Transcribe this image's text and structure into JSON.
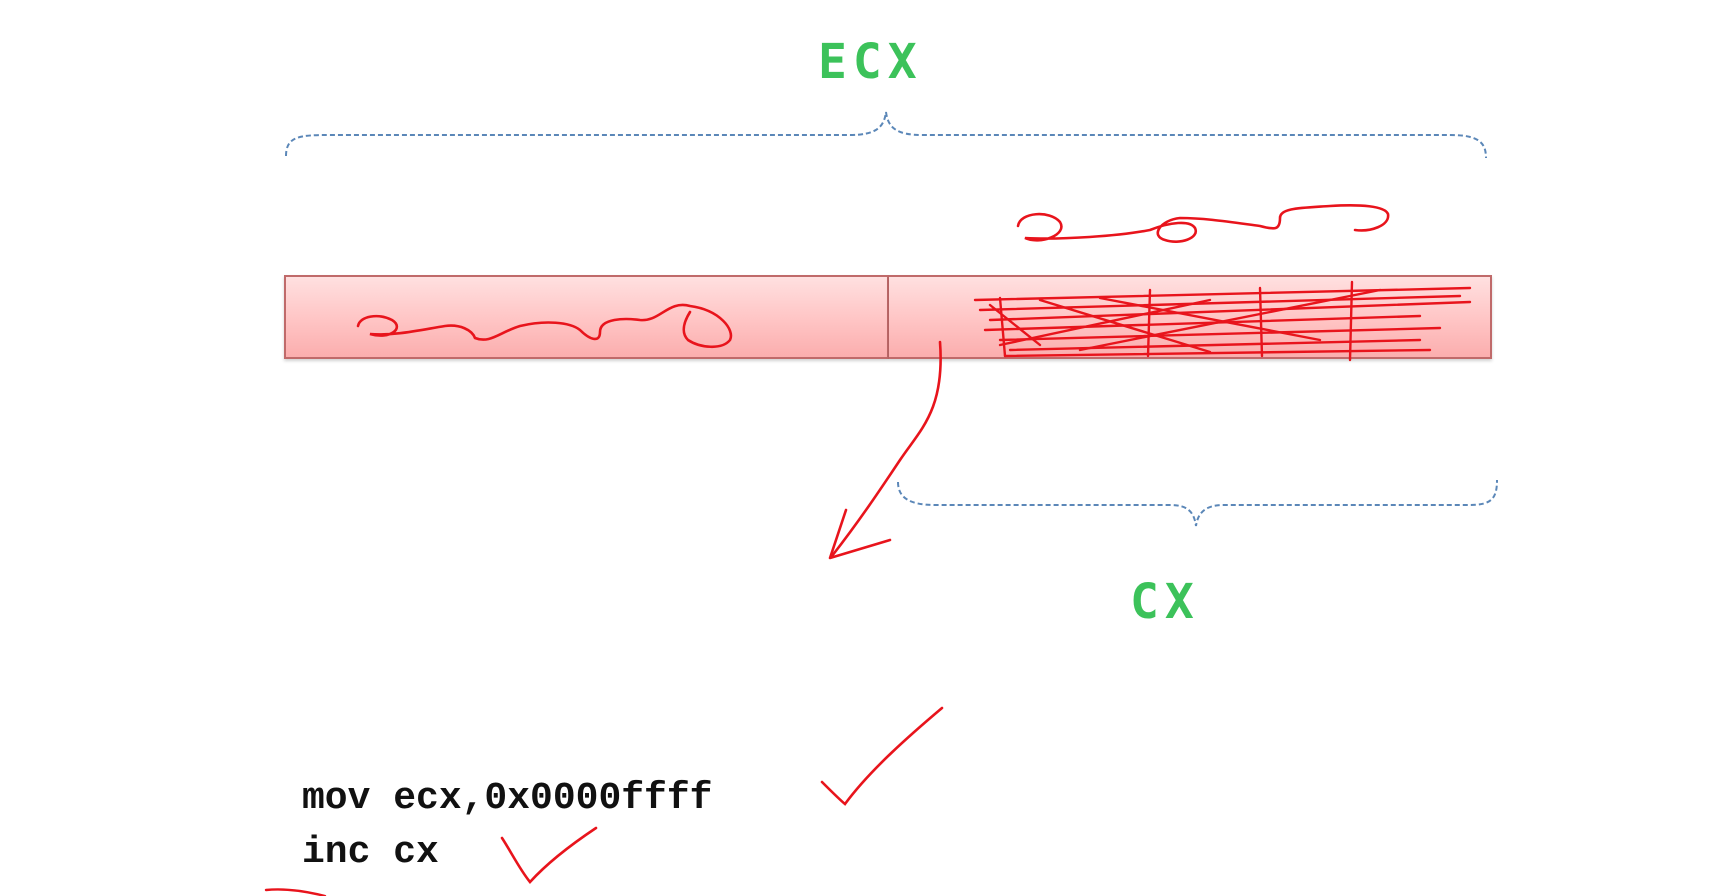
{
  "diagram": {
    "top_register_label": "ECX",
    "bottom_register_label": "CX",
    "colors": {
      "label": "#3cc25a",
      "brace": "#5b87b8",
      "ink": "#e8141c",
      "bar_fill": "#ffc4c4",
      "bar_border": "#c06a6a"
    }
  },
  "code": {
    "lines": [
      "mov ecx,0x0000ffff",
      "inc cx"
    ]
  },
  "annotations": {
    "icons": [
      "checkmark-icon",
      "arrow-icon",
      "scribble-icon"
    ]
  }
}
